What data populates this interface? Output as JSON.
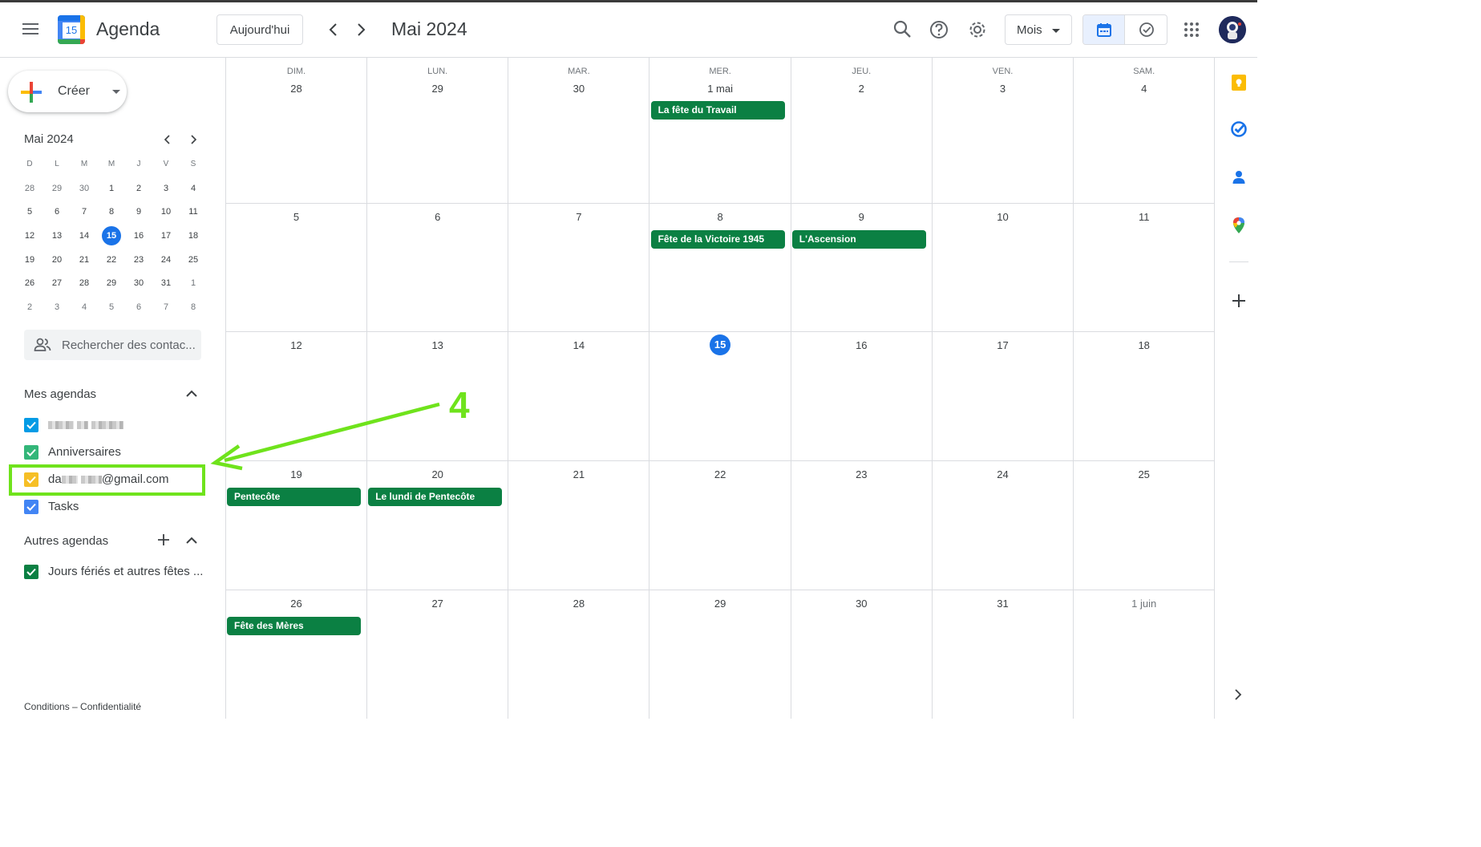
{
  "header": {
    "app_title": "Agenda",
    "logo_day": "15",
    "today_label": "Aujourd'hui",
    "month_title": "Mai 2024",
    "view_select": "Mois"
  },
  "create": {
    "label": "Créer"
  },
  "mini_cal": {
    "title": "Mai 2024",
    "day_headers": [
      "D",
      "L",
      "M",
      "M",
      "J",
      "V",
      "S"
    ],
    "weeks": [
      [
        {
          "d": "28",
          "o": true
        },
        {
          "d": "29",
          "o": true
        },
        {
          "d": "30",
          "o": true
        },
        {
          "d": "1"
        },
        {
          "d": "2"
        },
        {
          "d": "3"
        },
        {
          "d": "4"
        }
      ],
      [
        {
          "d": "5"
        },
        {
          "d": "6"
        },
        {
          "d": "7"
        },
        {
          "d": "8"
        },
        {
          "d": "9"
        },
        {
          "d": "10"
        },
        {
          "d": "11"
        }
      ],
      [
        {
          "d": "12"
        },
        {
          "d": "13"
        },
        {
          "d": "14"
        },
        {
          "d": "15",
          "t": true
        },
        {
          "d": "16"
        },
        {
          "d": "17"
        },
        {
          "d": "18"
        }
      ],
      [
        {
          "d": "19"
        },
        {
          "d": "20"
        },
        {
          "d": "21"
        },
        {
          "d": "22"
        },
        {
          "d": "23"
        },
        {
          "d": "24"
        },
        {
          "d": "25"
        }
      ],
      [
        {
          "d": "26"
        },
        {
          "d": "27"
        },
        {
          "d": "28"
        },
        {
          "d": "29"
        },
        {
          "d": "30"
        },
        {
          "d": "31"
        },
        {
          "d": "1",
          "o": true
        }
      ],
      [
        {
          "d": "2",
          "o": true
        },
        {
          "d": "3",
          "o": true
        },
        {
          "d": "4",
          "o": true
        },
        {
          "d": "5",
          "o": true
        },
        {
          "d": "6",
          "o": true
        },
        {
          "d": "7",
          "o": true
        },
        {
          "d": "8",
          "o": true
        }
      ]
    ]
  },
  "contact_search": {
    "placeholder": "Rechercher des contac..."
  },
  "my_calendars": {
    "title": "Mes agendas",
    "items": [
      {
        "name": "",
        "color": "#039be5"
      },
      {
        "name": "Anniversaires",
        "color": "#33b679"
      },
      {
        "name_prefix": "da",
        "name_suffix": "@gmail.com",
        "color": "#f6bf26"
      },
      {
        "name": "Tasks",
        "color": "#4285f4"
      }
    ]
  },
  "other_calendars": {
    "title": "Autres agendas",
    "items": [
      {
        "name": "Jours fériés et autres fêtes ...",
        "color": "#0b8043"
      }
    ]
  },
  "footer": {
    "text": "Conditions – Confidentialité"
  },
  "grid": {
    "day_names": [
      "DIM.",
      "LUN.",
      "MAR.",
      "MER.",
      "JEU.",
      "VEN.",
      "SAM."
    ],
    "weeks": [
      {
        "days": [
          {
            "n": "28"
          },
          {
            "n": "29"
          },
          {
            "n": "30"
          },
          {
            "n": "1 mai"
          },
          {
            "n": "2"
          },
          {
            "n": "3"
          },
          {
            "n": "4"
          }
        ]
      },
      {
        "days": [
          {
            "n": "5"
          },
          {
            "n": "6"
          },
          {
            "n": "7"
          },
          {
            "n": "8"
          },
          {
            "n": "9"
          },
          {
            "n": "10"
          },
          {
            "n": "11"
          }
        ]
      },
      {
        "days": [
          {
            "n": "12"
          },
          {
            "n": "13"
          },
          {
            "n": "14"
          },
          {
            "n": "15",
            "today": true
          },
          {
            "n": "16"
          },
          {
            "n": "17"
          },
          {
            "n": "18"
          }
        ]
      },
      {
        "days": [
          {
            "n": "19"
          },
          {
            "n": "20"
          },
          {
            "n": "21"
          },
          {
            "n": "22"
          },
          {
            "n": "23"
          },
          {
            "n": "24"
          },
          {
            "n": "25"
          }
        ]
      },
      {
        "days": [
          {
            "n": "26"
          },
          {
            "n": "27"
          },
          {
            "n": "28"
          },
          {
            "n": "29"
          },
          {
            "n": "30"
          },
          {
            "n": "31"
          },
          {
            "n": "1 juin",
            "dim": true
          }
        ]
      }
    ],
    "events": [
      {
        "week": 0,
        "day": 3,
        "title": "La fête du Travail"
      },
      {
        "week": 1,
        "day": 3,
        "title": "Fête de la Victoire 1945"
      },
      {
        "week": 1,
        "day": 4,
        "title": "L'Ascension"
      },
      {
        "week": 3,
        "day": 0,
        "title": "Pentecôte"
      },
      {
        "week": 3,
        "day": 1,
        "title": "Le lundi de Pentecôte"
      },
      {
        "week": 4,
        "day": 0,
        "title": "Fête des Mères"
      }
    ]
  },
  "annotation": {
    "number": "4",
    "color": "#6fe31c"
  },
  "colors": {
    "accent": "#1a73e8",
    "event": "#0b8043"
  }
}
